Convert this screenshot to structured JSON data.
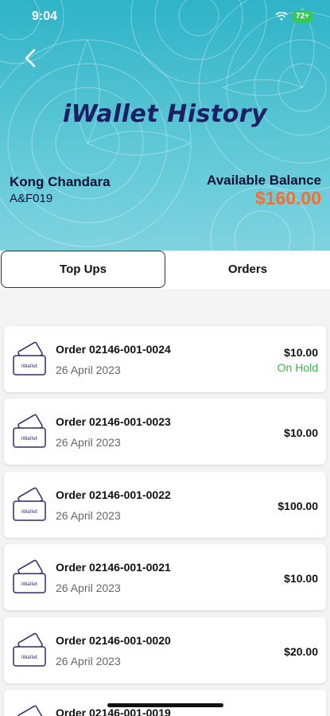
{
  "status_bar": {
    "time": "9:04",
    "battery": "72+"
  },
  "header": {
    "title": "iWallet History",
    "user_name": "Kong Chandara",
    "user_code": "A&F019",
    "balance_label": "Available Balance",
    "balance_value": "$160.00"
  },
  "tabs": [
    {
      "label": "Top Ups",
      "selected": true
    },
    {
      "label": "Orders",
      "selected": false
    }
  ],
  "icon_label": "iWallet",
  "orders": [
    {
      "order": "Order 02146-001-0024",
      "date": "26 April 2023",
      "amount": "$10.00",
      "status": "On Hold"
    },
    {
      "order": "Order 02146-001-0023",
      "date": "26 April 2023",
      "amount": "$10.00",
      "status": ""
    },
    {
      "order": "Order 02146-001-0022",
      "date": "26 April 2023",
      "amount": "$100.00",
      "status": ""
    },
    {
      "order": "Order 02146-001-0021",
      "date": "26 April 2023",
      "amount": "$10.00",
      "status": ""
    },
    {
      "order": "Order 02146-001-0020",
      "date": "26 April 2023",
      "amount": "$20.00",
      "status": ""
    },
    {
      "order": "Order 02146-001-0019",
      "date": "",
      "amount": "",
      "status": ""
    }
  ],
  "colors": {
    "accent": "#ff6b2d",
    "title": "#1c1f63",
    "status_on_hold": "#3cb049",
    "header": "#2fb3c8"
  }
}
